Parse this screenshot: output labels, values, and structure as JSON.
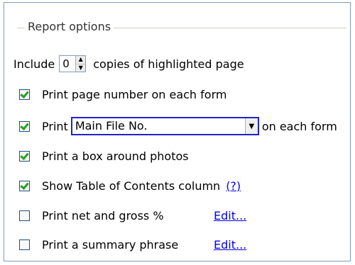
{
  "group": {
    "legend": "Report options"
  },
  "include": {
    "label": "Include",
    "copies_value": "0",
    "suffix": "copies of highlighted page"
  },
  "options": {
    "page_number": {
      "label": "Print page number on each form",
      "checked": true
    },
    "print_field": {
      "label": "Print",
      "selected": "Main File No.",
      "suffix": "on each form",
      "checked": true
    },
    "box_photos": {
      "label": "Print a box around photos",
      "checked": true
    },
    "toc": {
      "label": "Show Table of Contents column",
      "help": "(?)",
      "checked": true
    },
    "net_gross": {
      "label": "Print net and gross %",
      "edit": "Edit...",
      "checked": false
    },
    "summary": {
      "label": "Print a summary phrase",
      "edit": "Edit...",
      "checked": false
    }
  },
  "icons": {
    "spin_up": "up-arrow",
    "spin_down": "down-arrow",
    "dropdown": "chevron-down"
  },
  "colors": {
    "accent_border": "#2222cc",
    "check": "#21a121",
    "link": "#0000ee"
  }
}
